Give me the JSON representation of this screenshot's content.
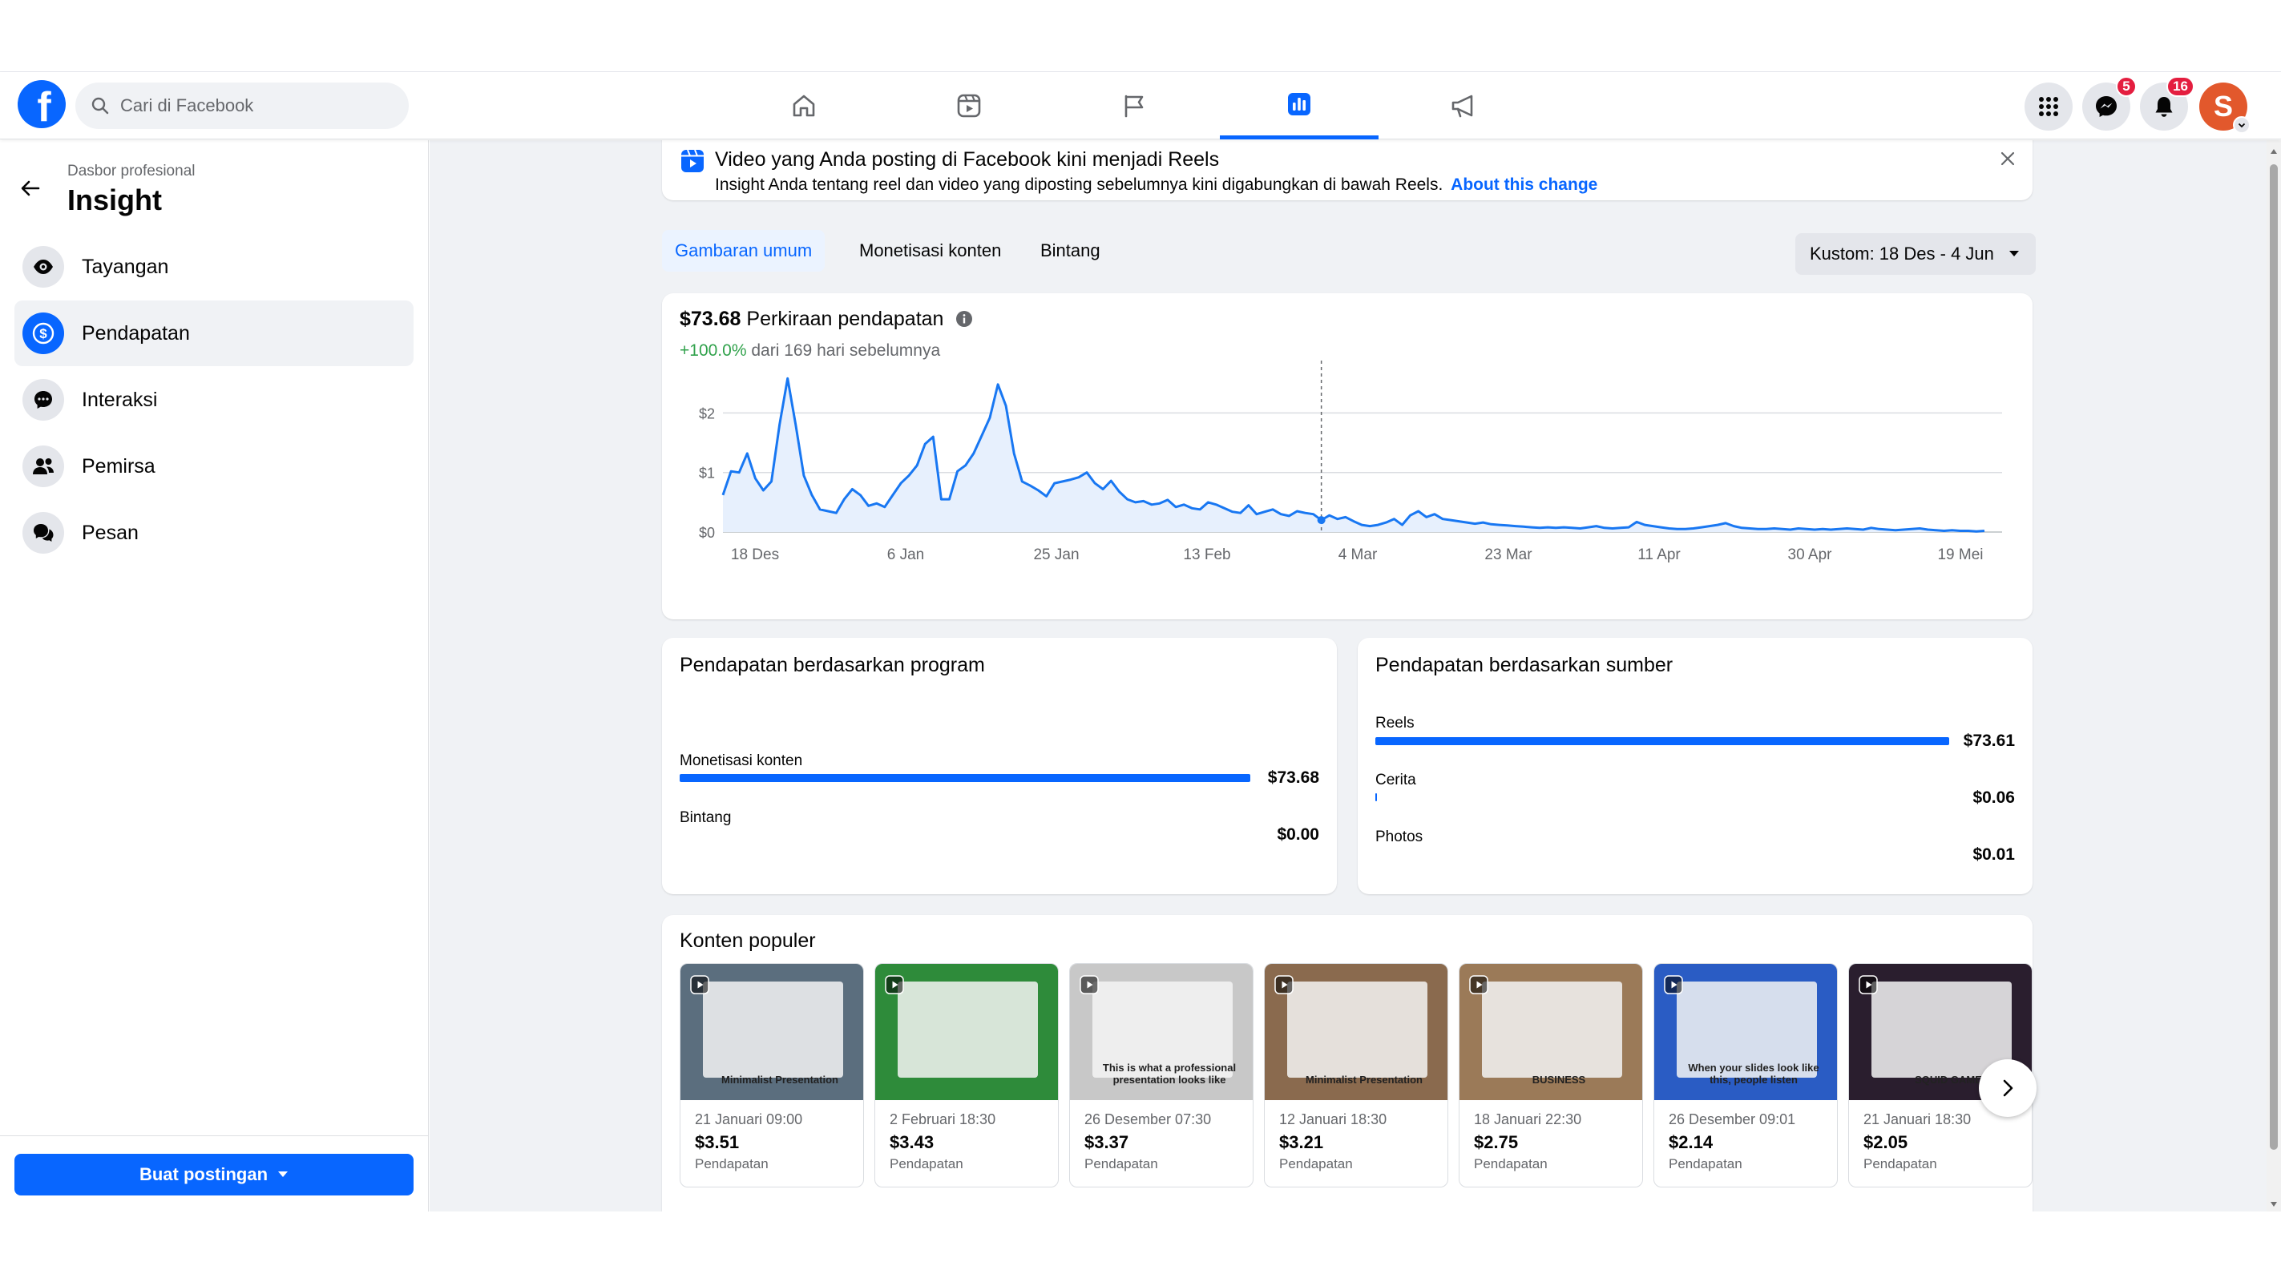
{
  "header": {
    "logo_letter": "f",
    "search_placeholder": "Cari di Facebook",
    "nav_tabs": [
      "home-icon",
      "reels-icon",
      "flag-icon",
      "insights-icon",
      "megaphone-icon"
    ],
    "messenger_badge": "5",
    "notifications_badge": "16",
    "avatar_letter": "S"
  },
  "sidebar": {
    "subtitle": "Dasbor profesional",
    "title": "Insight",
    "items": [
      {
        "label": "Tayangan",
        "icon": "eye-icon"
      },
      {
        "label": "Pendapatan",
        "icon": "dollar-icon"
      },
      {
        "label": "Interaksi",
        "icon": "chat-icon"
      },
      {
        "label": "Pemirsa",
        "icon": "people-icon"
      },
      {
        "label": "Pesan",
        "icon": "messages-icon"
      }
    ],
    "create_post_label": "Buat postingan"
  },
  "notice": {
    "title": "Video yang Anda posting di Facebook kini menjadi Reels",
    "text": "Insight Anda tentang reel dan video yang diposting sebelumnya kini digabungkan di bawah Reels.",
    "link": "About this change"
  },
  "tabs": [
    "Gambaran umum",
    "Monetisasi konten",
    "Bintang"
  ],
  "date_filter": "Kustom: 18 Des - 4 Jun",
  "earnings": {
    "amount": "$73.68",
    "label": "Perkiraan pendapatan",
    "change_pct": "+100.0%",
    "change_text": "dari 169 hari sebelumnya"
  },
  "chart_data": {
    "type": "area",
    "title": "",
    "xlabel": "",
    "ylabel": "",
    "x_tick_labels": [
      "18 Des",
      "6 Jan",
      "25 Jan",
      "13 Feb",
      "4 Mar",
      "23 Mar",
      "11 Apr",
      "30 Apr",
      "19 Mei"
    ],
    "y_tick_labels": [
      "$0",
      "$1",
      "$2"
    ],
    "ylim": [
      0,
      2.8
    ],
    "grid": true,
    "color": "#1877f2",
    "fill_color": "#e7f0fd",
    "values": [
      0.62,
      1.02,
      1.0,
      1.32,
      0.9,
      0.7,
      0.85,
      1.8,
      2.58,
      1.8,
      0.95,
      0.62,
      0.38,
      0.35,
      0.32,
      0.55,
      0.72,
      0.62,
      0.44,
      0.48,
      0.42,
      0.62,
      0.82,
      0.95,
      1.12,
      1.48,
      1.6,
      0.55,
      0.55,
      1.02,
      1.12,
      1.32,
      1.62,
      1.92,
      2.48,
      2.12,
      1.32,
      0.85,
      0.78,
      0.7,
      0.6,
      0.82,
      0.85,
      0.88,
      0.92,
      1.0,
      0.82,
      0.72,
      0.86,
      0.68,
      0.55,
      0.5,
      0.52,
      0.46,
      0.48,
      0.54,
      0.42,
      0.46,
      0.4,
      0.38,
      0.5,
      0.46,
      0.4,
      0.34,
      0.32,
      0.45,
      0.3,
      0.34,
      0.38,
      0.3,
      0.27,
      0.35,
      0.32,
      0.3,
      0.2,
      0.28,
      0.22,
      0.25,
      0.18,
      0.12,
      0.1,
      0.12,
      0.16,
      0.22,
      0.12,
      0.28,
      0.35,
      0.25,
      0.3,
      0.22,
      0.2,
      0.18,
      0.16,
      0.14,
      0.16,
      0.13,
      0.12,
      0.11,
      0.1,
      0.09,
      0.08,
      0.07,
      0.08,
      0.07,
      0.08,
      0.07,
      0.06,
      0.08,
      0.1,
      0.07,
      0.06,
      0.07,
      0.08,
      0.17,
      0.12,
      0.1,
      0.08,
      0.06,
      0.05,
      0.05,
      0.06,
      0.08,
      0.1,
      0.12,
      0.15,
      0.1,
      0.07,
      0.06,
      0.05,
      0.05,
      0.06,
      0.05,
      0.04,
      0.06,
      0.05,
      0.04,
      0.05,
      0.04,
      0.05,
      0.06,
      0.05,
      0.04,
      0.07,
      0.05,
      0.04,
      0.03,
      0.04,
      0.05,
      0.06,
      0.04,
      0.03,
      0.02,
      0.03,
      0.02,
      0.02,
      0.01,
      0.02
    ]
  },
  "by_program": {
    "title": "Pendapatan berdasarkan program",
    "rows": [
      {
        "label": "Monetisasi konten",
        "value": "$73.68",
        "fraction": 1.0
      },
      {
        "label": "Bintang",
        "value": "$0.00",
        "fraction": 0.0
      }
    ]
  },
  "by_source": {
    "title": "Pendapatan berdasarkan sumber",
    "rows": [
      {
        "label": "Reels",
        "value": "$73.61",
        "fraction": 1.0
      },
      {
        "label": "Cerita",
        "value": "$0.06",
        "fraction": 0.001
      },
      {
        "label": "Photos",
        "value": "$0.01",
        "fraction": 0.0
      }
    ]
  },
  "popular": {
    "title": "Konten populer",
    "items": [
      {
        "date": "21 Januari 09:00",
        "amount": "$3.51",
        "sub": "Pendapatan",
        "thumb_caption": "Minimalist Presentation",
        "bg": "#5b6e7e"
      },
      {
        "date": "2 Februari 18:30",
        "amount": "$3.43",
        "sub": "Pendapatan",
        "thumb_caption": "",
        "bg": "#2e8b3a"
      },
      {
        "date": "26 Desember 07:30",
        "amount": "$3.37",
        "sub": "Pendapatan",
        "thumb_caption": "This is what a professional presentation looks like",
        "bg": "#c8c8c8"
      },
      {
        "date": "12 Januari 18:30",
        "amount": "$3.21",
        "sub": "Pendapatan",
        "thumb_caption": "Minimalist Presentation",
        "bg": "#8a6a4e"
      },
      {
        "date": "18 Januari 22:30",
        "amount": "$2.75",
        "sub": "Pendapatan",
        "thumb_caption": "BUSINESS",
        "bg": "#9b7a58"
      },
      {
        "date": "26 Desember 09:01",
        "amount": "$2.14",
        "sub": "Pendapatan",
        "thumb_caption": "When your slides look like this, people listen",
        "bg": "#2a5cc4"
      },
      {
        "date": "21 Januari 18:30",
        "amount": "$2.05",
        "sub": "Pendapatan",
        "thumb_caption": "SQUID GAME",
        "bg": "#2a1e2e"
      }
    ]
  }
}
